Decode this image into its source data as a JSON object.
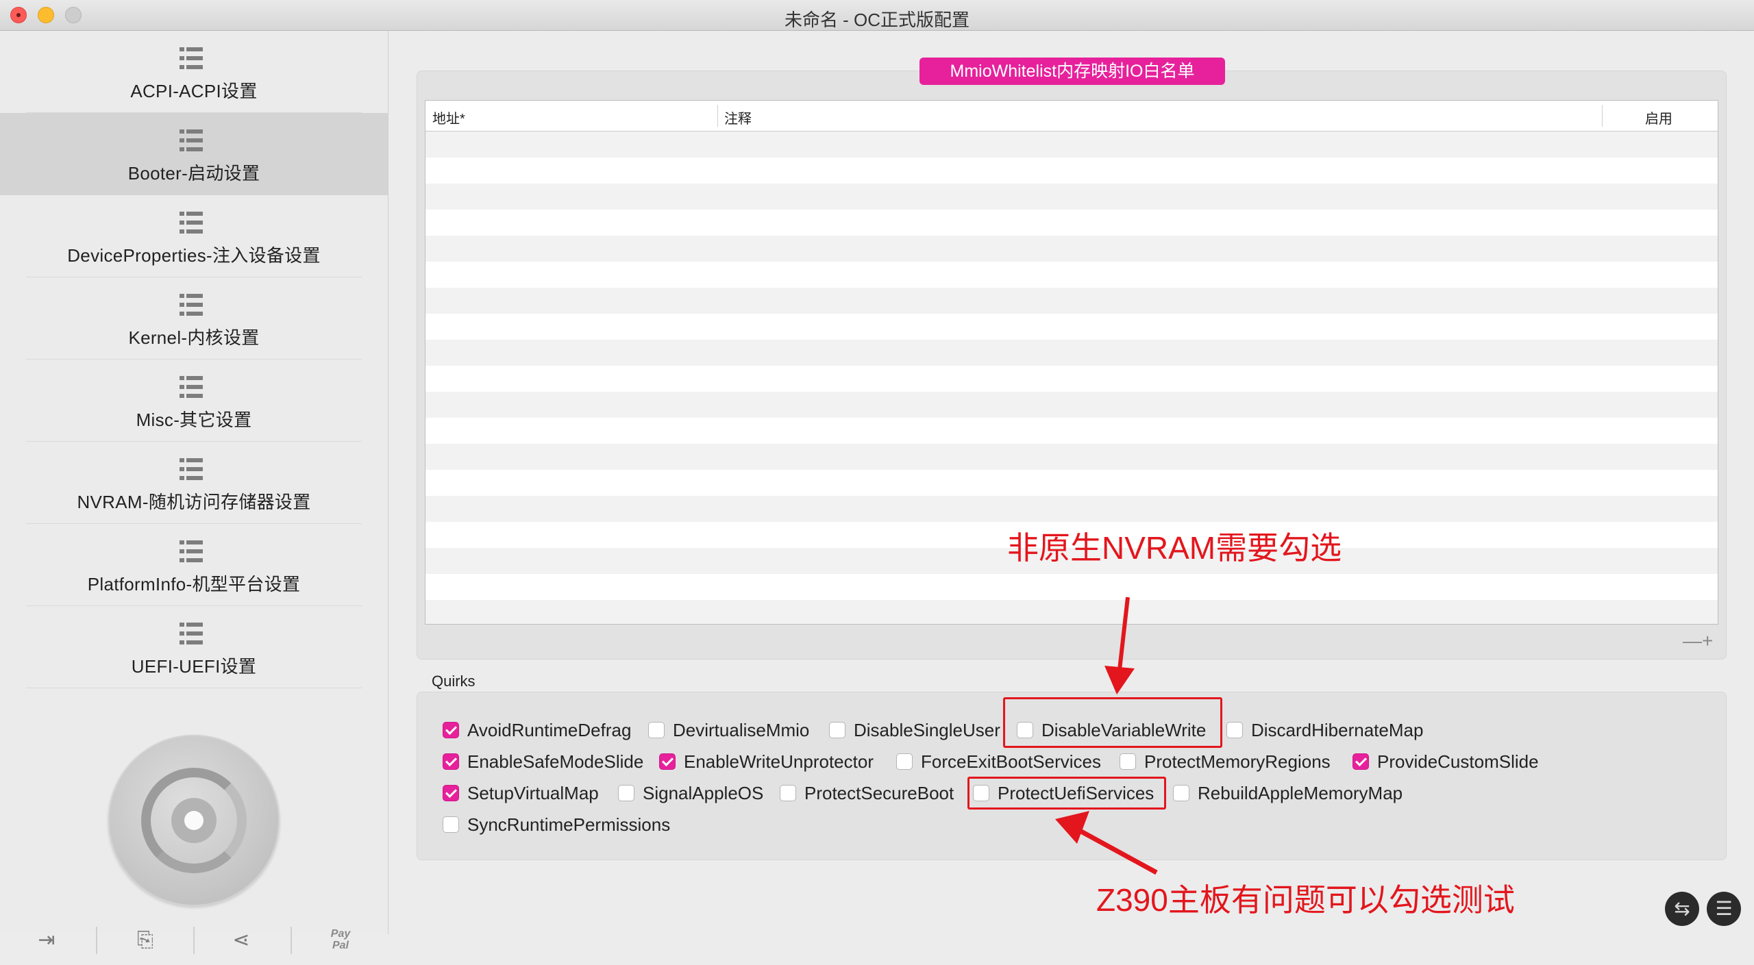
{
  "window": {
    "title": "未命名 - OC正式版配置"
  },
  "sidebar": {
    "items": [
      {
        "label": "ACPI-ACPI设置",
        "selected": false
      },
      {
        "label": "Booter-启动设置",
        "selected": true
      },
      {
        "label": "DeviceProperties-注入设备设置",
        "selected": false
      },
      {
        "label": "Kernel-内核设置",
        "selected": false
      },
      {
        "label": "Misc-其它设置",
        "selected": false
      },
      {
        "label": "NVRAM-随机访问存储器设置",
        "selected": false
      },
      {
        "label": "PlatformInfo-机型平台设置",
        "selected": false
      },
      {
        "label": "UEFI-UEFI设置",
        "selected": false
      }
    ],
    "bottom_tools": [
      "import-icon",
      "export-icon",
      "share-icon",
      "paypal-icon"
    ],
    "paypal_line1": "Pay",
    "paypal_line2": "Pal"
  },
  "mmio": {
    "header": "MmioWhitelist内存映射IO白名单",
    "columns": [
      "地址*",
      "注释",
      "启用"
    ],
    "rows": [],
    "minus_label": "—",
    "plus_label": "+"
  },
  "quirks": {
    "label": "Quirks",
    "items": [
      {
        "name": "AvoidRuntimeDefrag",
        "checked": true
      },
      {
        "name": "DevirtualiseMmio",
        "checked": false
      },
      {
        "name": "DisableSingleUser",
        "checked": false
      },
      {
        "name": "DisableVariableWrite",
        "checked": false
      },
      {
        "name": "DiscardHibernateMap",
        "checked": false
      },
      {
        "name": "EnableSafeModeSlide",
        "checked": true
      },
      {
        "name": "EnableWriteUnprotector",
        "checked": true
      },
      {
        "name": "ForceExitBootServices",
        "checked": false
      },
      {
        "name": "ProtectMemoryRegions",
        "checked": false
      },
      {
        "name": "ProvideCustomSlide",
        "checked": true
      },
      {
        "name": "SetupVirtualMap",
        "checked": true
      },
      {
        "name": "SignalAppleOS",
        "checked": false
      },
      {
        "name": "ProtectSecureBoot",
        "checked": false
      },
      {
        "name": "ProtectUefiServices",
        "checked": false
      },
      {
        "name": "RebuildAppleMemoryMap",
        "checked": false
      },
      {
        "name": "SyncRuntimePermissions",
        "checked": false
      }
    ]
  },
  "annotations": {
    "top": "非原生NVRAM需要勾选",
    "bottom": "Z390主板有问题可以勾选测试",
    "color": "#e3161d"
  },
  "colors": {
    "accent": "#e6219b",
    "selection": "#d4d4d4"
  },
  "bottom_buttons": [
    "swap-icon",
    "list-icon"
  ]
}
